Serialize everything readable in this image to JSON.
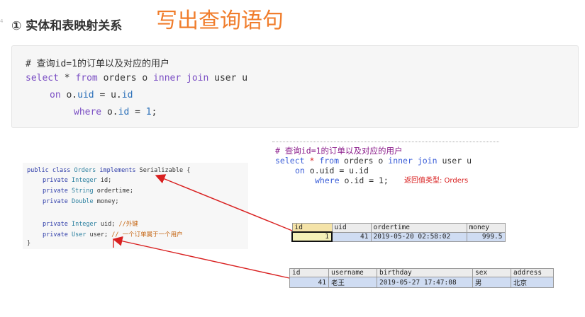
{
  "gutter": "4",
  "heading": {
    "title": "① 实体和表映射关系",
    "note": "写出查询语句"
  },
  "code_block": {
    "comment": "# 查询id=1的订单以及对应的用户",
    "line1": {
      "kw1": "select",
      "star": " * ",
      "kw2": "from",
      "t1": " orders o ",
      "kw3": "inner join",
      "t2": " user u"
    },
    "line2": {
      "kw": "on",
      "t1": " o.",
      "f1": "uid",
      "t2": " = u.",
      "f2": "id"
    },
    "line3": {
      "kw": "where",
      "t1": " o.",
      "f1": "id",
      "t2": " = ",
      "n": "1",
      "t3": ";"
    }
  },
  "java_class": {
    "l1": {
      "a": "public class ",
      "b": "Orders",
      "c": " implements ",
      "d": "Serializable",
      "e": " {"
    },
    "l2": {
      "a": "private ",
      "b": "Integer",
      "c": " id;"
    },
    "l3": {
      "a": "private ",
      "b": "String",
      "c": " ordertime;"
    },
    "l4": {
      "a": "private ",
      "b": "Double",
      "c": " money;"
    },
    "l5": {
      "a": "private ",
      "b": "Integer",
      "c": " uid; ",
      "d": "//外键"
    },
    "l6": {
      "a": "private ",
      "b": "User",
      "c": " user; ",
      "d": "// 一个订单属于一个用户"
    },
    "l7": "}"
  },
  "sql_shot": {
    "comment": "# 查询id=1的订单以及对应的用户",
    "l1": {
      "kw1": "select",
      "star": " * ",
      "kw2": "from",
      "t1": " orders o ",
      "kw3": "inner join",
      "t2": " user u"
    },
    "l2": {
      "kw": "on",
      "t1": " o.uid = u.id"
    },
    "l3": {
      "kw": "where",
      "t1": " o.id = 1;"
    },
    "return_note": "返回值类型: Orders"
  },
  "orders_table": {
    "headers": [
      "id",
      "uid",
      "ordertime",
      "money"
    ],
    "row": [
      "1",
      "41",
      "2019-05-20 02:58:02",
      "999.5"
    ]
  },
  "user_table": {
    "headers": [
      "id",
      "username",
      "birthday",
      "sex",
      "address"
    ],
    "row": [
      "41",
      "老王",
      "2019-05-27 17:47:08",
      "男",
      "北京"
    ]
  },
  "colors": {
    "accent_orange": "#f07d2c",
    "arrow_red": "#d92020",
    "keyword_purple": "#7b4fc4"
  }
}
